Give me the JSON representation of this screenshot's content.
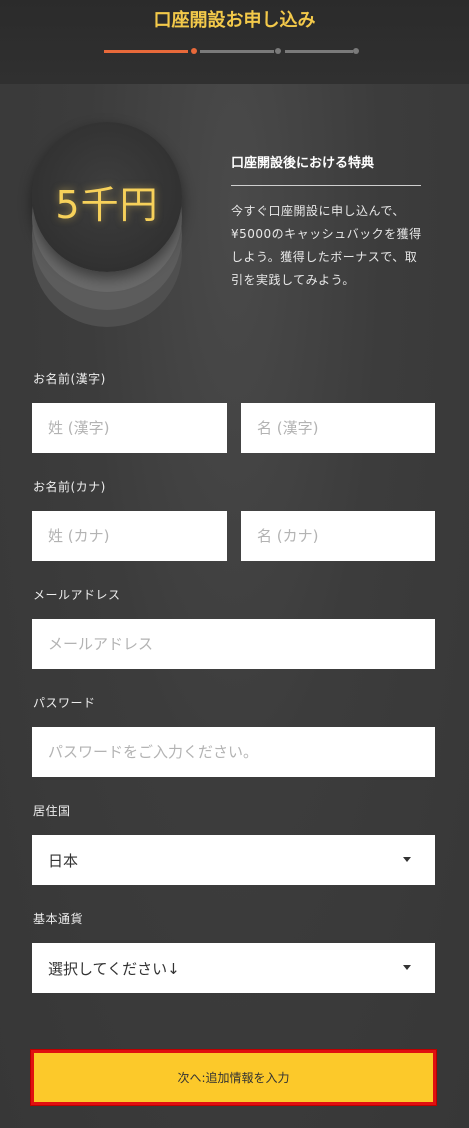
{
  "header": {
    "title": "口座開設お申し込み"
  },
  "progress": {
    "current_step": 1,
    "total_steps": 3,
    "colors": {
      "active": "#e8693a",
      "inactive": "#7a7a7a"
    }
  },
  "bonus": {
    "coin_label": "5千円",
    "title": "口座開設後における特典",
    "body": "今すぐ口座開設に申し込んで、¥5000のキャッシュバックを獲得しよう。獲得したボーナスで、取引を実践してみよう。"
  },
  "form": {
    "name_kanji": {
      "label": "お名前(漢字)",
      "last_placeholder": "姓 (漢字)",
      "first_placeholder": "名 (漢字)"
    },
    "name_kana": {
      "label": "お名前(カナ)",
      "last_placeholder": "姓 (カナ)",
      "first_placeholder": "名 (カナ)"
    },
    "email": {
      "label": "メールアドレス",
      "placeholder": "メールアドレス"
    },
    "password": {
      "label": "パスワード",
      "placeholder": "パスワードをご入力ください。"
    },
    "country": {
      "label": "居住国",
      "value": "日本"
    },
    "currency": {
      "label": "基本通貨",
      "value": "選択してください↓"
    }
  },
  "submit": {
    "label": "次へ:追加情報を入力",
    "color": "#fcc92a",
    "highlight_color": "#e01010"
  }
}
